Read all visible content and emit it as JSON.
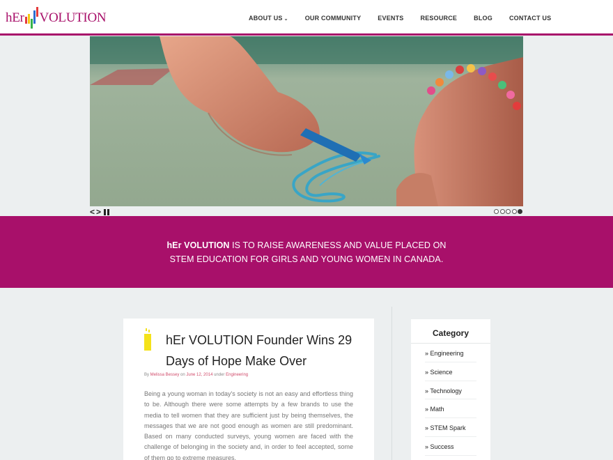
{
  "header": {
    "logo_prefix": "hEr",
    "logo_suffix": "VOLUTION",
    "nav": [
      {
        "label": "ABOUT US",
        "has_dropdown": true
      },
      {
        "label": "OUR COMMUNITY"
      },
      {
        "label": "EVENTS"
      },
      {
        "label": "RESOURCE"
      },
      {
        "label": "BLOG"
      },
      {
        "label": "CONTACT US"
      }
    ]
  },
  "slider": {
    "prev_label": "<",
    "next_label": ">",
    "slide_count": 5,
    "active_slide": 5
  },
  "mission": {
    "brand": "hEr VOLUTION",
    "text": " IS TO RAISE AWARENESS AND VALUE PLACED ON STEM EDUCATION FOR GIRLS AND YOUNG WOMEN IN CANADA."
  },
  "post": {
    "title": "hEr VOLUTION Founder Wins 29 Days of Hope Make Over",
    "meta": {
      "by": "By ",
      "author": "Melissa Bessey",
      "on": " on ",
      "date": "June 12, 2014",
      "under": " under ",
      "category": "Engineering"
    },
    "excerpt": "Being a young woman in today's society is not an easy and effortless thing to be. Although there were some attempts by a few brands to use the media to tell women that they are sufficient just by being themselves, the messages that we are not good enough as women are still predominant. Based on many conducted surveys, young women are faced with the challenge of belonging in the society and, in order to feel accepted, some of them go to extreme measures."
  },
  "sidebar": {
    "title": "Category",
    "categories": [
      "» Engineering",
      "» Science",
      "» Technology",
      "» Math",
      "» STEM Spark",
      "» Success"
    ]
  },
  "colors": {
    "brand": "#a8106a",
    "link": "#d04a6a",
    "background": "#eceff0"
  }
}
